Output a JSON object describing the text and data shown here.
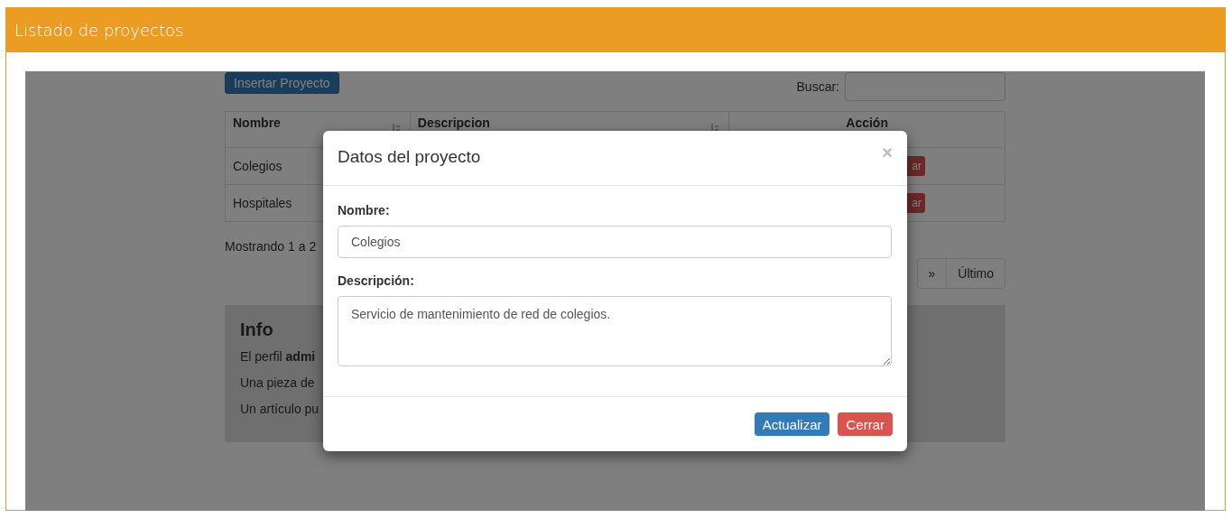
{
  "header": {
    "title": "Listado de proyectos"
  },
  "toolbar": {
    "insert_button": "Insertar Proyecto",
    "search_label": "Buscar:"
  },
  "table": {
    "columns": [
      "Nombre",
      "Descripcion",
      "Acción"
    ],
    "rows": [
      {
        "nombre": "Colegios",
        "action": "ar"
      },
      {
        "nombre": "Hospitales",
        "action": "ar"
      }
    ]
  },
  "summary": "Mostrando 1 a 2",
  "pagination": [
    "»",
    "Último"
  ],
  "info": {
    "title": "Info",
    "paragraphs": [
      "El perfil **admi**",
      "Una pieza de",
      "Un artículo pu"
    ]
  },
  "modal": {
    "title": "Datos del proyecto",
    "close": "×",
    "fields": [
      {
        "kind": "input",
        "label": "Nombre:",
        "value": "Colegios"
      },
      {
        "kind": "textarea",
        "label": "Descripción:",
        "value": "Servicio de mantenimiento de red de colegios."
      }
    ],
    "buttons": [
      {
        "kind": "primary",
        "label": "Actualizar"
      },
      {
        "kind": "danger",
        "label": "Cerrar"
      }
    ]
  }
}
